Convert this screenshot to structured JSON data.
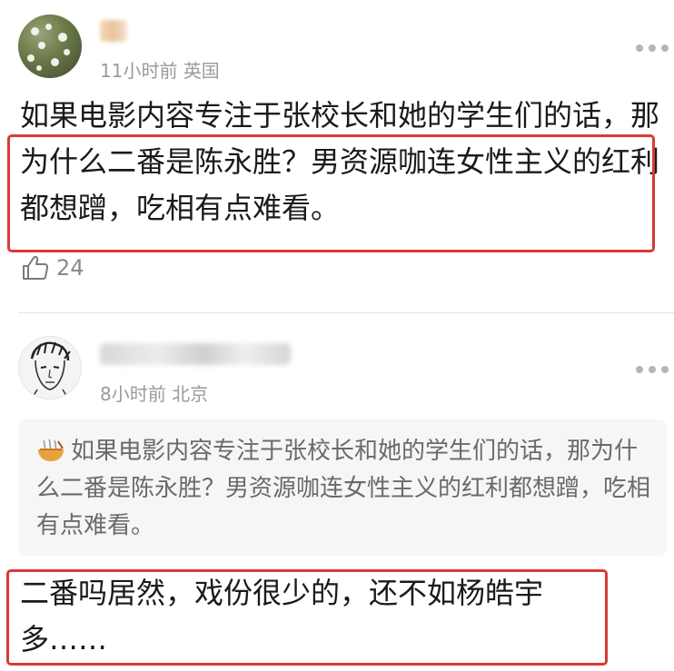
{
  "comments": [
    {
      "time": "11小时前",
      "location": "英国",
      "text": "如果电影内容专注于张校长和她的学生们的话，那为什么二番是陈永胜？男资源咖连女性主义的红利都想蹭，吃相有点难看。",
      "likes": "24"
    },
    {
      "time": "8小时前",
      "location": "北京",
      "quote": "如果电影内容专注于张校长和她的学生们的话，那为什么二番是陈永胜？男资源咖连女性主义的红利都想蹭，吃相有点难看。",
      "text": "二番吗居然，戏份很少的，还不如杨皓宇多……"
    }
  ],
  "icons": {
    "like": "thumbs-up-icon",
    "more": "more-dots-icon",
    "quote": "noodle-bowl-emoji"
  },
  "colors": {
    "highlight_border": "#d93a37",
    "meta_text": "#9a9a9a",
    "quote_bg": "#f6f6f6"
  }
}
